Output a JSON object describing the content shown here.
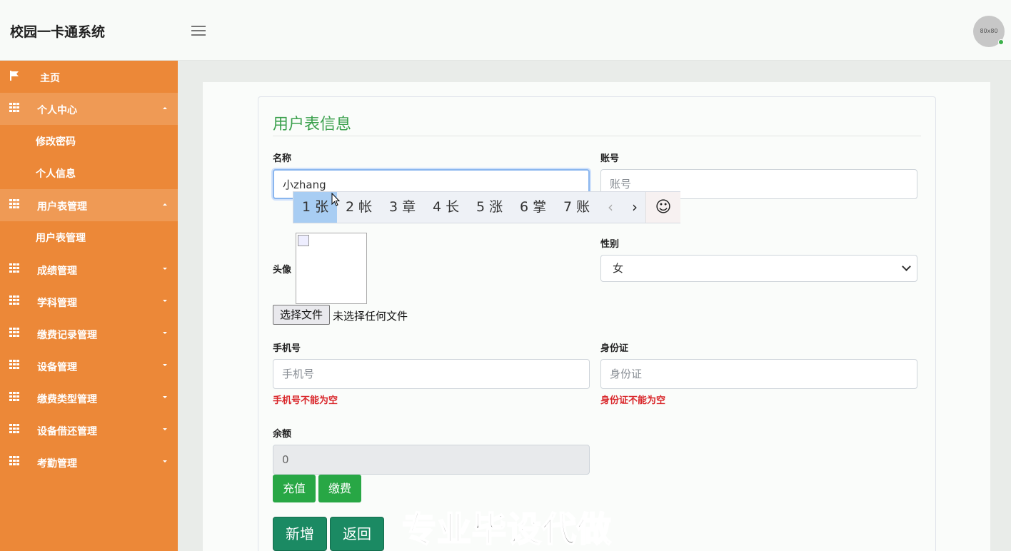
{
  "header": {
    "app_title": "校园一卡通系统",
    "avatar_text": "80x80"
  },
  "sidebar": {
    "home": "主页",
    "personal_center": "个人中心",
    "change_password": "修改密码",
    "personal_info": "个人信息",
    "user_table_mgmt": "用户表管理",
    "user_table_sub": "用户表管理",
    "score_mgmt": "成绩管理",
    "subject_mgmt": "学科管理",
    "payment_record_mgmt": "缴费记录管理",
    "device_mgmt": "设备管理",
    "payment_type_mgmt": "缴费类型管理",
    "device_borrow_mgmt": "设备借还管理",
    "attendance_mgmt": "考勤管理"
  },
  "form": {
    "title": "用户表信息",
    "name_label": "名称",
    "name_value": "小zhang",
    "account_label": "账号",
    "account_placeholder": "账号",
    "avatar_label": "头像",
    "file_button": "选择文件",
    "file_status": "未选择任何文件",
    "gender_label": "性别",
    "gender_value": "女",
    "phone_label": "手机号",
    "phone_placeholder": "手机号",
    "phone_error": "手机号不能为空",
    "idcard_label": "身份证",
    "idcard_placeholder": "身份证",
    "idcard_error": "身份证不能为空",
    "balance_label": "余额",
    "balance_value": "0",
    "recharge_button": "充值",
    "pay_button": "缴费",
    "add_button": "新增",
    "back_button": "返回"
  },
  "ime": {
    "candidates": [
      "1 张",
      "2 帐",
      "3 章",
      "4 长",
      "5 涨",
      "6 掌",
      "7 账"
    ],
    "prev": "‹",
    "next": "›",
    "emoji": "☺"
  },
  "watermark": "专业毕设代做"
}
